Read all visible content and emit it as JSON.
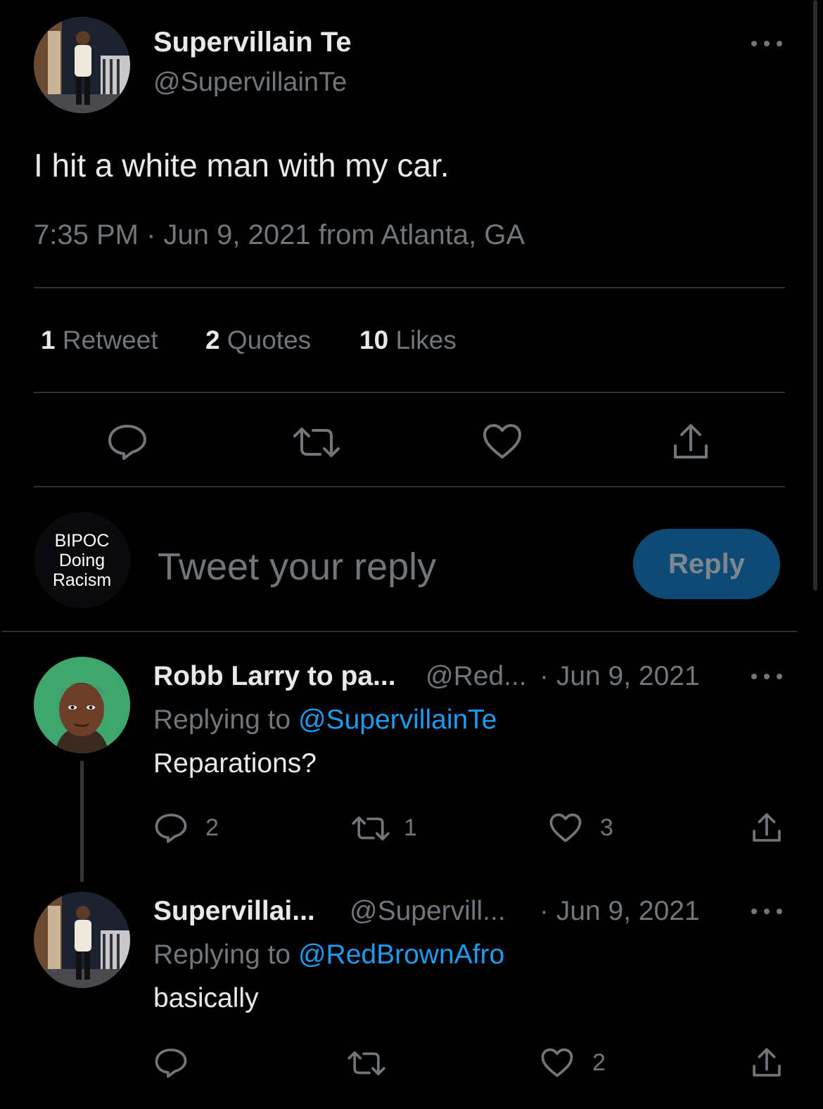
{
  "main_tweet": {
    "display_name": "Supervillain Te",
    "handle": "@SupervillainTe",
    "text": "I hit a white man with my car.",
    "meta": "7:35 PM · Jun 9, 2021 from Atlanta, GA",
    "stats": {
      "retweets_num": "1",
      "retweets_label": "Retweet",
      "quotes_num": "2",
      "quotes_label": "Quotes",
      "likes_num": "10",
      "likes_label": "Likes"
    }
  },
  "composer": {
    "avatar_text": [
      "BIPOC",
      "Doing",
      "Racism"
    ],
    "placeholder": "Tweet your reply",
    "button": "Reply"
  },
  "replies": [
    {
      "display_name": "Robb Larry to pa...",
      "handle": "@Red...",
      "date": "· Jun 9, 2021",
      "replying_prefix": "Replying to",
      "replying_to": "@SupervillainTe",
      "text": "Reparations?",
      "reply_count": "2",
      "retweet_count": "1",
      "like_count": "3"
    },
    {
      "display_name": "Supervillai...",
      "handle": "@Supervill...",
      "date": "· Jun 9, 2021",
      "replying_prefix": "Replying to",
      "replying_to": "@RedBrownAfro",
      "text": "basically",
      "reply_count": "",
      "retweet_count": "",
      "like_count": "2"
    }
  ],
  "colors": {
    "accent": "#1d9bf0",
    "reply_button": "#0e4a73",
    "muted": "#71767b",
    "divider": "#2f3336"
  }
}
